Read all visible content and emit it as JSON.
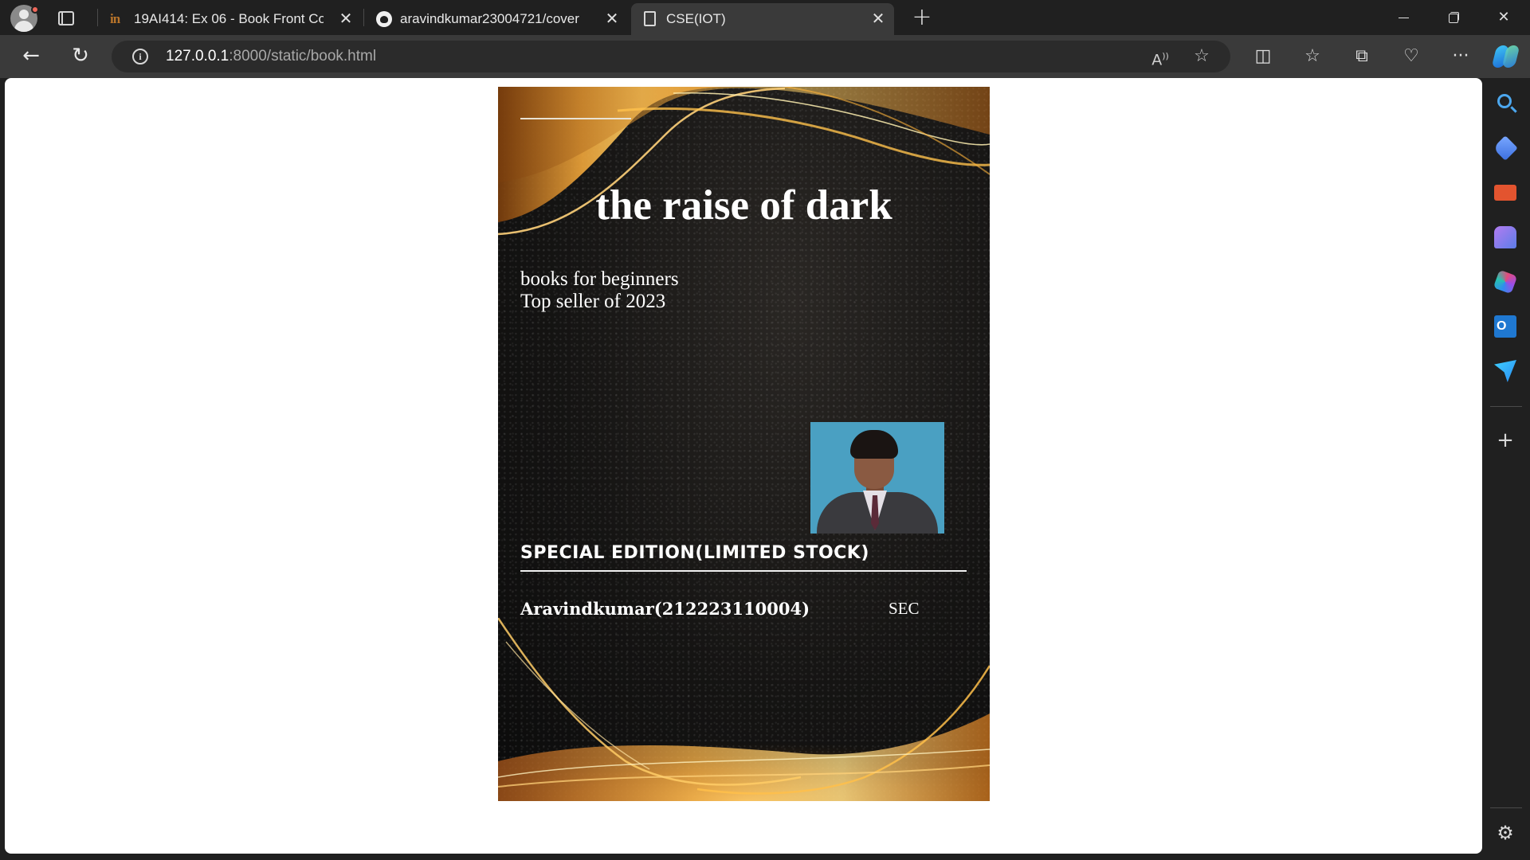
{
  "browser": {
    "tabs": [
      {
        "title": "19AI414: Ex 06 - Book Front Cove",
        "favicon": "in-icon",
        "active": false
      },
      {
        "title": "aravindkumar23004721/cover",
        "favicon": "github-icon",
        "active": false
      },
      {
        "title": "CSE(IOT)",
        "favicon": "page-icon",
        "active": true
      }
    ],
    "address": {
      "host": "127.0.0.1",
      "rest": ":8000/static/book.html"
    },
    "read_aloud_label": "A̅"
  },
  "cover": {
    "title": "the raise of dark",
    "subtitle_line1": "books for beginners",
    "subtitle_line2": "Top seller of 2023",
    "edition": "SPECIAL EDITION(LIMITED STOCK)",
    "author": "Aravindkumar(212223110004)",
    "college": "SEC"
  },
  "colors": {
    "browser_bg": "#202020",
    "toolbar_bg": "#3a3a3a",
    "cover_gold": "#e8a33a"
  }
}
